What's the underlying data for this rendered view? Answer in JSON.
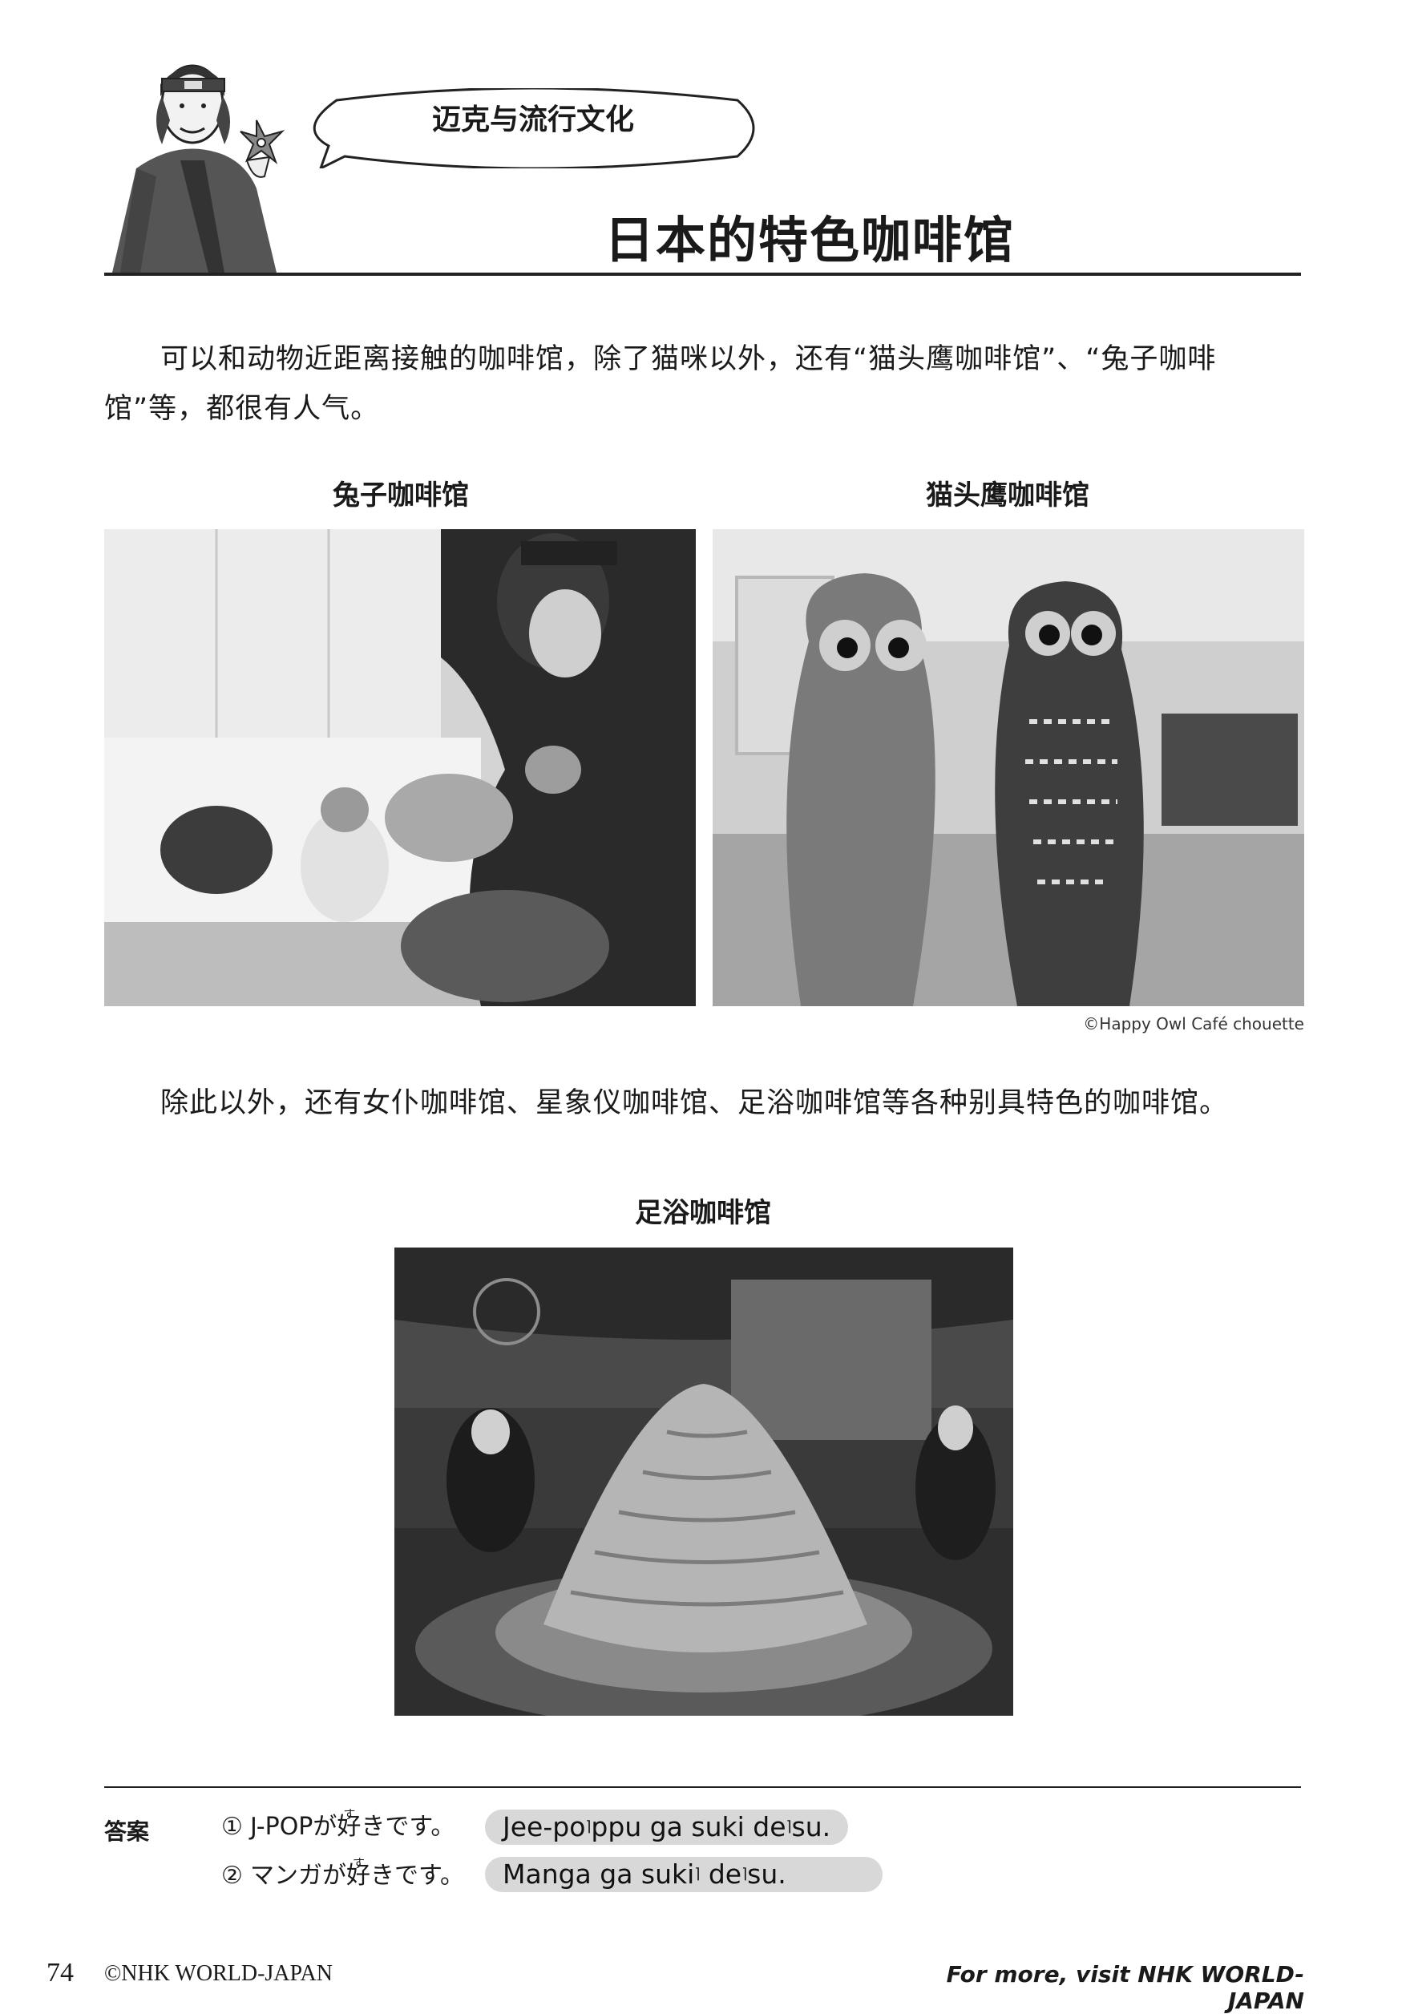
{
  "header": {
    "bubble_text": "迈克与流行文化",
    "title": "日本的特色咖啡馆"
  },
  "intro": "可以和动物近距离接触的咖啡馆，除了猫咪以外，还有“猫头鹰咖啡馆”、“兔子咖啡馆”等，都很有人气。",
  "photos": {
    "rabbit_caption": "兔子咖啡馆",
    "owl_caption": "猫头鹰咖啡馆",
    "owl_credit": "©Happy Owl Café chouette",
    "foot_caption": "足浴咖啡馆"
  },
  "more_text": "除此以外，还有女仆咖啡馆、星象仪咖啡馆、足浴咖啡馆等各种别具特色的咖啡馆。",
  "answers": {
    "label": "答案",
    "items": [
      {
        "num": "①",
        "pre": "J-POPが",
        "kanji": "好",
        "furigana": "す",
        "post": "きです。",
        "romaji_a": "Jee-po",
        "romaji_b": "ppu ga suki de",
        "romaji_c": "su."
      },
      {
        "num": "②",
        "pre": "マンガが",
        "kanji": "好",
        "furigana": "す",
        "post": "きです。",
        "romaji_a": "Manga ga suki",
        "romaji_b": " de",
        "romaji_c": "su."
      }
    ]
  },
  "footer": {
    "page_number": "74",
    "copyright": "©NHK WORLD-JAPAN",
    "visit": "For more, visit NHK WORLD-JAPAN"
  },
  "colors": {
    "text": "#1a1a1a",
    "pill": "#d8d8d8",
    "rule": "#222222"
  }
}
